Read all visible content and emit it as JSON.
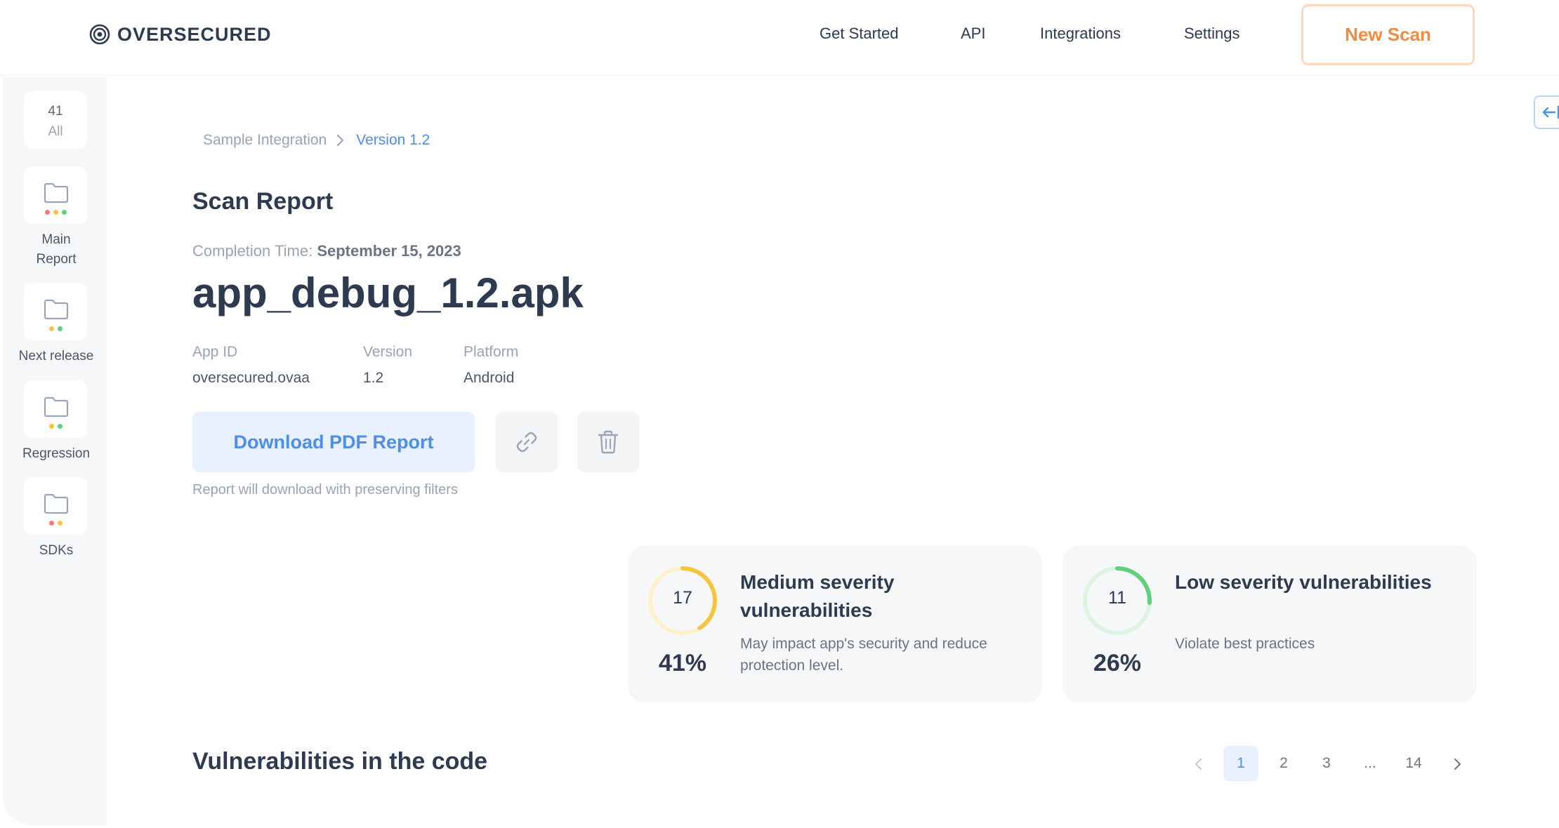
{
  "header": {
    "brand": "OVERSECURED",
    "nav": [
      "Get Started",
      "API",
      "Integrations",
      "Settings"
    ],
    "new_scan_label": "New Scan"
  },
  "sidebar": {
    "all": {
      "count": "41",
      "label": "All"
    },
    "folders": [
      {
        "label_lines": [
          "Main",
          "Report"
        ],
        "dots": [
          "#f27b73",
          "#f5c542",
          "#5fd07c"
        ]
      },
      {
        "label_lines": [
          "Next release"
        ],
        "dots": [
          "#f5c542",
          "#5fd07c"
        ]
      },
      {
        "label_lines": [
          "Regression"
        ],
        "dots": [
          "#f5c542",
          "#5fd07c"
        ]
      },
      {
        "label_lines": [
          "SDKs"
        ],
        "dots": [
          "#f27b73",
          "#f5c542"
        ]
      }
    ]
  },
  "breadcrumb": {
    "parent": "Sample Integration",
    "current": "Version 1.2"
  },
  "report": {
    "heading": "Scan Report",
    "completion_label": "Completion Time:",
    "completion_date": "September 15, 2023",
    "file_name": "app_debug_1.2.apk",
    "meta": [
      {
        "label": "App ID",
        "value": "oversecured.ovaa"
      },
      {
        "label": "Version",
        "value": "1.2"
      },
      {
        "label": "Platform",
        "value": "Android"
      }
    ],
    "download_label": "Download PDF Report",
    "download_note": "Report will download with preserving filters"
  },
  "severity": [
    {
      "count": "17",
      "percent": "41%",
      "fraction": 0.41,
      "color": "#f5c542",
      "track": "#fdf0cc",
      "title": "Medium severity vulnerabilities",
      "description": "May impact app's security and reduce protection level."
    },
    {
      "count": "11",
      "percent": "26%",
      "fraction": 0.26,
      "color": "#5fd07c",
      "track": "#dcf5e3",
      "title": "Low severity vulnerabilities",
      "description": "Violate best practices"
    }
  ],
  "vulnerabilities": {
    "heading": "Vulnerabilities in the code",
    "pages": [
      "1",
      "2",
      "3",
      "...",
      "14"
    ],
    "current_page": "1"
  },
  "colors": {
    "accent": "#4d8ee9",
    "new_scan": "#f38a3d"
  }
}
